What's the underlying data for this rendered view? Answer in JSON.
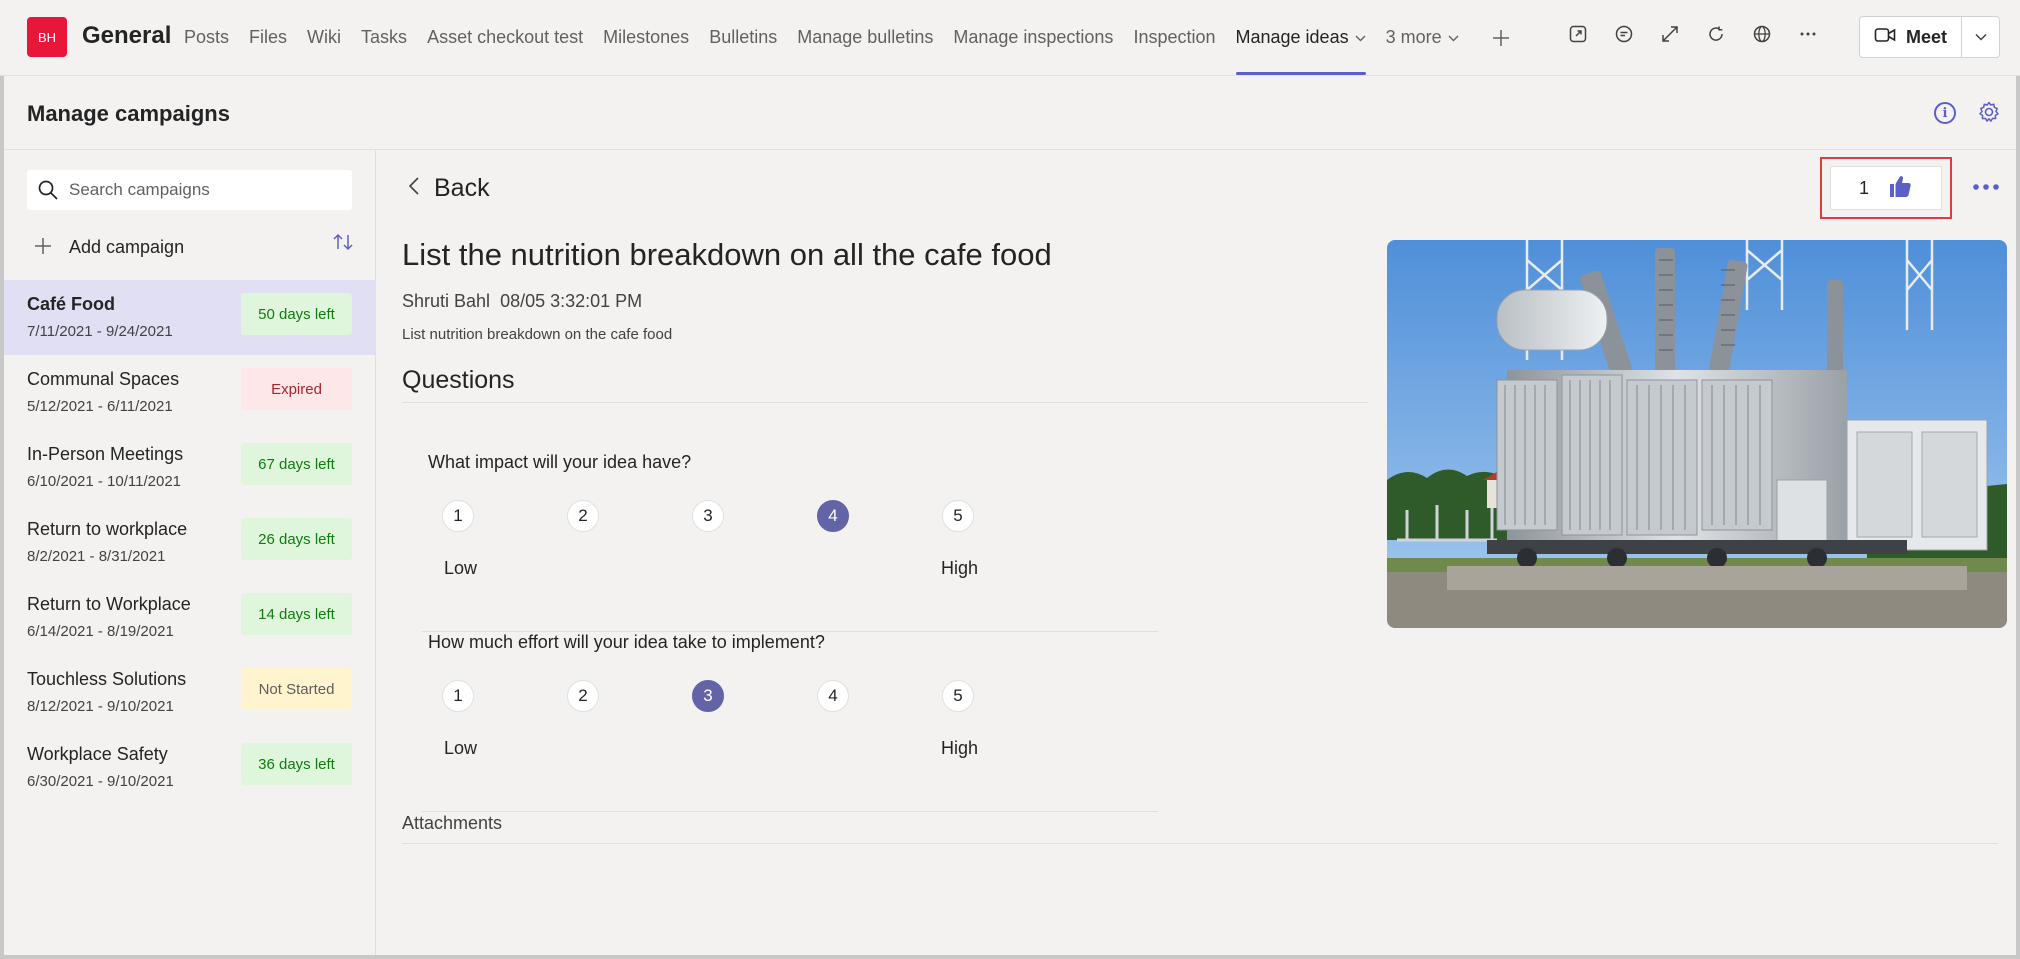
{
  "team": {
    "avatar_initials": "BH",
    "channel": "General"
  },
  "tabs": [
    {
      "label": "Posts",
      "active": false
    },
    {
      "label": "Files",
      "active": false
    },
    {
      "label": "Wiki",
      "active": false
    },
    {
      "label": "Tasks",
      "active": false
    },
    {
      "label": "Asset checkout test",
      "active": false
    },
    {
      "label": "Milestones",
      "active": false
    },
    {
      "label": "Bulletins",
      "active": false
    },
    {
      "label": "Manage bulletins",
      "active": false
    },
    {
      "label": "Manage inspections",
      "active": false
    },
    {
      "label": "Inspection",
      "active": false
    },
    {
      "label": "Manage ideas",
      "active": true,
      "dropdown": true
    },
    {
      "label": "3 more",
      "active": false,
      "dropdown": true
    }
  ],
  "toolbar": {
    "icons": [
      "popout-icon",
      "chat-icon",
      "expand-icon",
      "refresh-icon",
      "globe-icon",
      "more-horizontal-icon"
    ],
    "meet_label": "Meet"
  },
  "page": {
    "title": "Manage campaigns"
  },
  "sidebar": {
    "search_placeholder": "Search campaigns",
    "add_label": "Add campaign",
    "campaigns": [
      {
        "name": "Café Food",
        "dates": "7/11/2021 - 9/24/2021",
        "status": "50 days left",
        "status_type": "green",
        "selected": true
      },
      {
        "name": "Communal Spaces",
        "dates": "5/12/2021 - 6/11/2021",
        "status": "Expired",
        "status_type": "red",
        "selected": false
      },
      {
        "name": "In-Person Meetings",
        "dates": "6/10/2021 - 10/11/2021",
        "status": "67 days left",
        "status_type": "green",
        "selected": false
      },
      {
        "name": "Return to workplace",
        "dates": "8/2/2021 - 8/31/2021",
        "status": "26 days left",
        "status_type": "green",
        "selected": false
      },
      {
        "name": "Return to Workplace",
        "dates": "6/14/2021 - 8/19/2021",
        "status": "14 days left",
        "status_type": "green",
        "selected": false
      },
      {
        "name": "Touchless Solutions",
        "dates": "8/12/2021 - 9/10/2021",
        "status": "Not Started",
        "status_type": "yellow",
        "selected": false
      },
      {
        "name": "Workplace Safety",
        "dates": "6/30/2021 - 9/10/2021",
        "status": "36 days left",
        "status_type": "green",
        "selected": false
      }
    ]
  },
  "idea": {
    "back_label": "Back",
    "likes": "1",
    "title": "List the nutrition breakdown on all the cafe food",
    "author": "Shruti Bahl",
    "timestamp": "08/05 3:32:01 PM",
    "description": "List nutrition breakdown on the cafe food",
    "questions_heading": "Questions",
    "questions": [
      {
        "text": "What impact will your idea have?",
        "options": [
          "1",
          "2",
          "3",
          "4",
          "5"
        ],
        "selected": "4",
        "low_label": "Low",
        "high_label": "High"
      },
      {
        "text": "How much effort will your idea take to implement?",
        "options": [
          "1",
          "2",
          "3",
          "4",
          "5"
        ],
        "selected": "3",
        "low_label": "Low",
        "high_label": "High"
      }
    ],
    "attachments_label": "Attachments"
  },
  "colors": {
    "accent": "#5b5fc7",
    "rating_selected": "#6264a7",
    "highlight_box": "#e03c3c",
    "team_avatar": "#e8173a"
  }
}
